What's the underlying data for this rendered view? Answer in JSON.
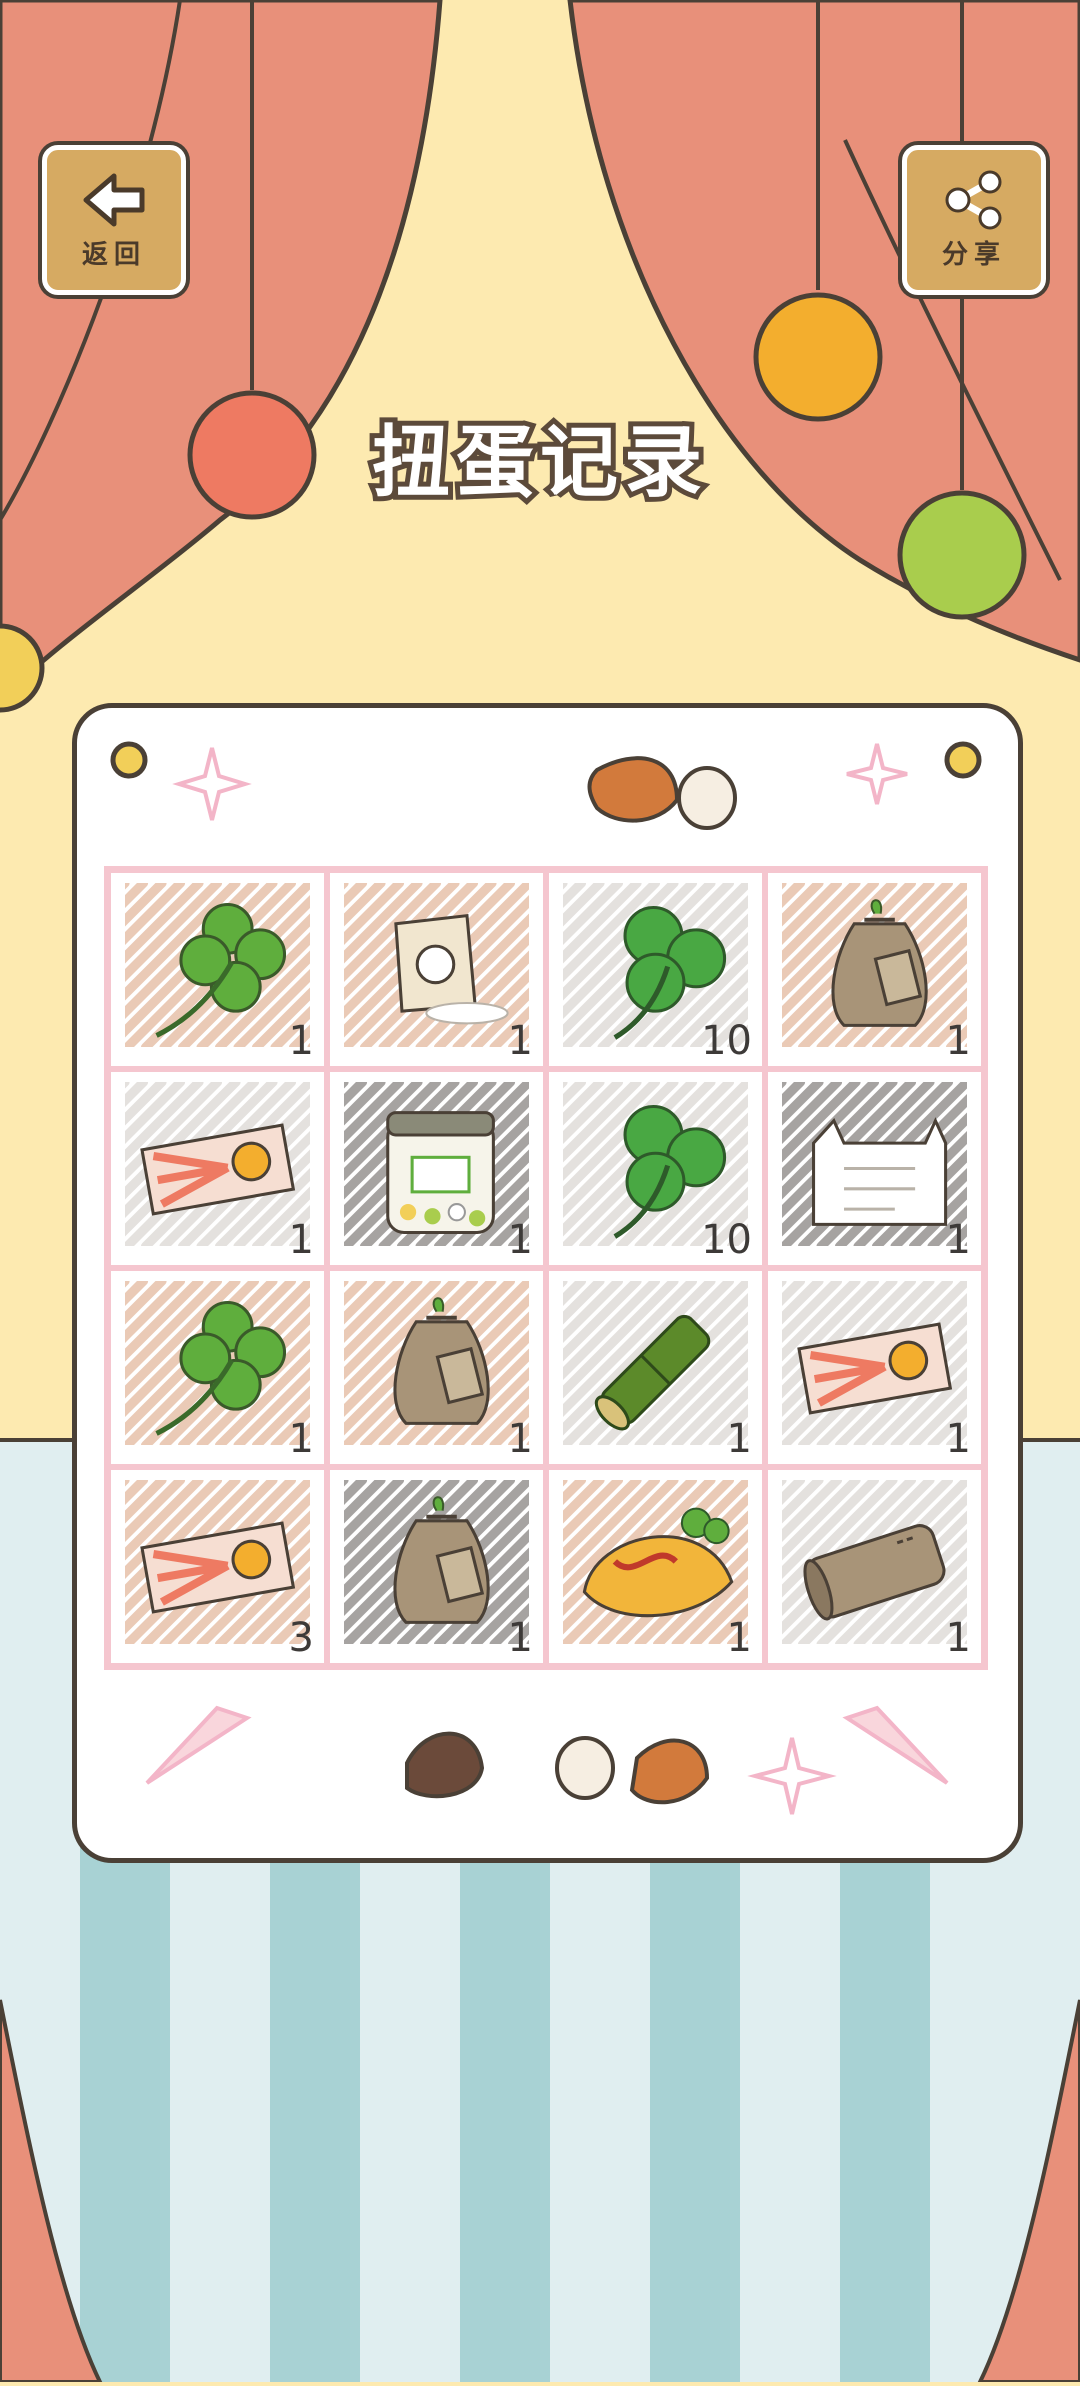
{
  "header": {
    "back_label": "返回",
    "share_label": "分享",
    "title": "扭蛋记录"
  },
  "grid": {
    "items": [
      {
        "name": "four-leaf-clover",
        "count": "1",
        "hatch": "#d9a07c"
      },
      {
        "name": "salt-bag",
        "count": "1",
        "hatch": "#d9a07c"
      },
      {
        "name": "three-leaf-clover",
        "count": "10",
        "hatch": "#cfcac4"
      },
      {
        "name": "seed-bag",
        "count": "1",
        "hatch": "#d9a07c"
      },
      {
        "name": "ticket",
        "count": "1",
        "hatch": "#cfcac4"
      },
      {
        "name": "candy-jar",
        "count": "1",
        "hatch": "#5e5856"
      },
      {
        "name": "three-leaf-clover",
        "count": "10",
        "hatch": "#cfcac4"
      },
      {
        "name": "cat-letter",
        "count": "1",
        "hatch": "#5e5856"
      },
      {
        "name": "four-leaf-clover",
        "count": "1",
        "hatch": "#d9a07c"
      },
      {
        "name": "seed-bag",
        "count": "1",
        "hatch": "#d9a07c"
      },
      {
        "name": "bamboo",
        "count": "1",
        "hatch": "#cfcac4"
      },
      {
        "name": "ticket",
        "count": "1",
        "hatch": "#cfcac4"
      },
      {
        "name": "ticket",
        "count": "3",
        "hatch": "#d9a07c"
      },
      {
        "name": "seed-bag",
        "count": "1",
        "hatch": "#5e5856"
      },
      {
        "name": "omelette",
        "count": "1",
        "hatch": "#d9a07c"
      },
      {
        "name": "cloth-roll",
        "count": "1",
        "hatch": "#cfcac4"
      }
    ]
  },
  "colors": {
    "curtain": "#e8907a",
    "backdrop": "#fdeab0",
    "floor_light": "#e0eef0",
    "floor_stripe": "#a8d2d4",
    "outline": "#4a4036",
    "cell_border": "#f5c6cf",
    "wood": "#d6aa62"
  }
}
